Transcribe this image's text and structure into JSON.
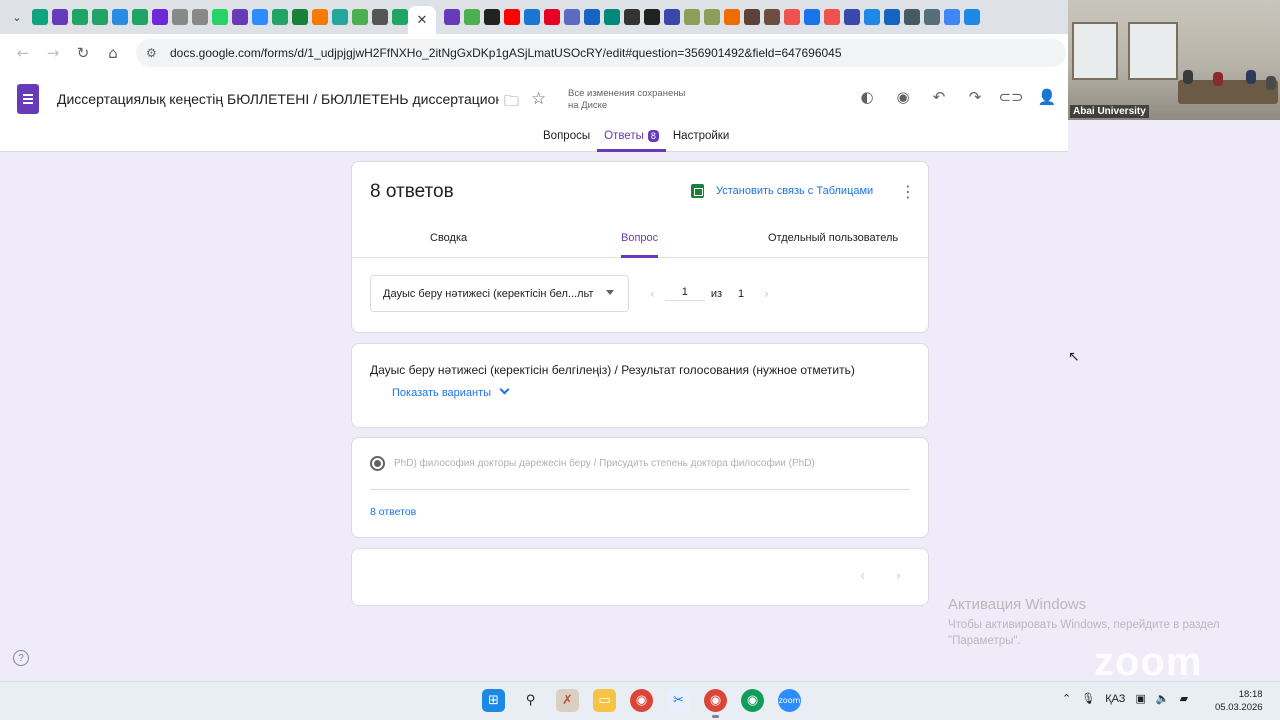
{
  "browser": {
    "tab_favicons": [
      {
        "name": "chatgpt-tab-icon",
        "color": "#10a37f"
      },
      {
        "name": "forms-tab-icon",
        "color": "#673ab7"
      },
      {
        "name": "drive-tab-icon",
        "color": "#1fa463"
      },
      {
        "name": "drive-tab-icon-2",
        "color": "#1fa463"
      },
      {
        "name": "site-tab-icon-blue",
        "color": "#2b8ae2"
      },
      {
        "name": "drive-tab-icon-3",
        "color": "#1fa463"
      },
      {
        "name": "site-tab-icon-purple",
        "color": "#6d28d9"
      },
      {
        "name": "site-tab-icon-white",
        "color": "#888888"
      },
      {
        "name": "site-tab-icon-white-2",
        "color": "#888888"
      },
      {
        "name": "whatsapp-tab-icon",
        "color": "#25d366"
      },
      {
        "name": "forms-tab-icon-2",
        "color": "#673ab7"
      },
      {
        "name": "zoom-tab-icon",
        "color": "#2d8cff"
      },
      {
        "name": "drive-tab-icon-4",
        "color": "#1fa463"
      },
      {
        "name": "plus-tab-icon",
        "color": "#188038"
      },
      {
        "name": "site-tab-icon-sc",
        "color": "#f57c00"
      },
      {
        "name": "site-tab-icon-teal",
        "color": "#26a69a"
      },
      {
        "name": "site-tab-icon-b",
        "color": "#4caf50"
      },
      {
        "name": "site-tab-icon-dark",
        "color": "#555555"
      },
      {
        "name": "drive-tab-icon-5",
        "color": "#1fa463"
      }
    ],
    "active_tab_close": "✕",
    "tab_favicons_right": [
      {
        "name": "forms-tab-icon-3",
        "color": "#673ab7"
      },
      {
        "name": "site-tab-icon-7",
        "color": "#4caf50"
      },
      {
        "name": "site-tab-icon-8",
        "color": "#222222"
      },
      {
        "name": "youtube-tab-icon",
        "color": "#ff0000"
      },
      {
        "name": "site-tab-icon-9",
        "color": "#1976d2"
      },
      {
        "name": "pinterest-tab-icon",
        "color": "#e60023"
      },
      {
        "name": "site-tab-icon-10",
        "color": "#5c6bc0"
      },
      {
        "name": "site-tab-icon-11",
        "color": "#1565c0"
      },
      {
        "name": "site-tab-icon-12",
        "color": "#00897b"
      },
      {
        "name": "site-tab-icon-13",
        "color": "#333333"
      },
      {
        "name": "site-tab-icon-14",
        "color": "#222222"
      },
      {
        "name": "site-tab-icon-15",
        "color": "#3949ab"
      },
      {
        "name": "site-tab-icon-16",
        "color": "#8d9f5a"
      },
      {
        "name": "site-tab-icon-17",
        "color": "#8d9f5a"
      },
      {
        "name": "site-tab-icon-18",
        "color": "#ef6c00"
      },
      {
        "name": "site-tab-icon-19",
        "color": "#5d4037"
      },
      {
        "name": "site-tab-icon-20",
        "color": "#6d4c41"
      },
      {
        "name": "site-tab-icon-21",
        "color": "#ef5350"
      },
      {
        "name": "gmail-tab-icon",
        "color": "#1a73e8"
      },
      {
        "name": "site-tab-icon-22",
        "color": "#ef5350"
      },
      {
        "name": "forms-tab-icon-4",
        "color": "#3949ab"
      },
      {
        "name": "site-tab-icon-23",
        "color": "#1e88e5"
      },
      {
        "name": "site-tab-icon-24",
        "color": "#1565c0"
      },
      {
        "name": "site-tab-icon-25",
        "color": "#455a64"
      },
      {
        "name": "site-tab-icon-26",
        "color": "#546e7a"
      },
      {
        "name": "google-tab-icon",
        "color": "#4285f4"
      },
      {
        "name": "site-tab-icon-27",
        "color": "#1e88e5"
      }
    ],
    "url": "docs.google.com/forms/d/1_udjpjgjwH2FfNXHo_2itNgGxDKp1gASjLmatUSOcRY/edit#question=356901492&field=647696045"
  },
  "header": {
    "title": "Диссертациялық кеңестің БЮЛЛЕТЕНІ / БЮЛЛЕТЕНЬ диссертационного совета",
    "save_status": "Все изменения сохранены на Диске",
    "tabs": [
      {
        "label": "Вопросы"
      },
      {
        "label": "Ответы",
        "badge": "8"
      },
      {
        "label": "Настройки"
      }
    ]
  },
  "responses": {
    "count_label": "8 ответов",
    "sheets_link": "Установить связь с Таблицами",
    "view_tabs": [
      "Сводка",
      "Вопрос",
      "Отдельный пользователь"
    ],
    "selected_question": "Дауыс беру нәтижесі (керектісін бел...льт",
    "pager_current": "1",
    "pager_of": "из",
    "pager_total": "1"
  },
  "question": {
    "title": "Дауыс беру нәтижесі (керектісін белгілеңіз) / Результат голосования (нужное отметить)",
    "show_options": "Показать варианты",
    "option_label": "PhD) философия докторы дәрежесін беру / Присудить степень доктора философии (PhD)",
    "answers_link": "8 ответов"
  },
  "video": {
    "label": "Abai University"
  },
  "windows": {
    "activate_title": "Активация Windows",
    "activate_text": "Чтобы активировать Windows, перейдите в раздел \"Параметры\".",
    "zoom_watermark": "zoom"
  },
  "taskbar": {
    "language": "ҚАЗ",
    "time": "18:18",
    "date": "05.03.2026"
  },
  "colors": {
    "accent": "#673ab7",
    "link": "#1a73e8",
    "background": "#f0ebf8"
  }
}
